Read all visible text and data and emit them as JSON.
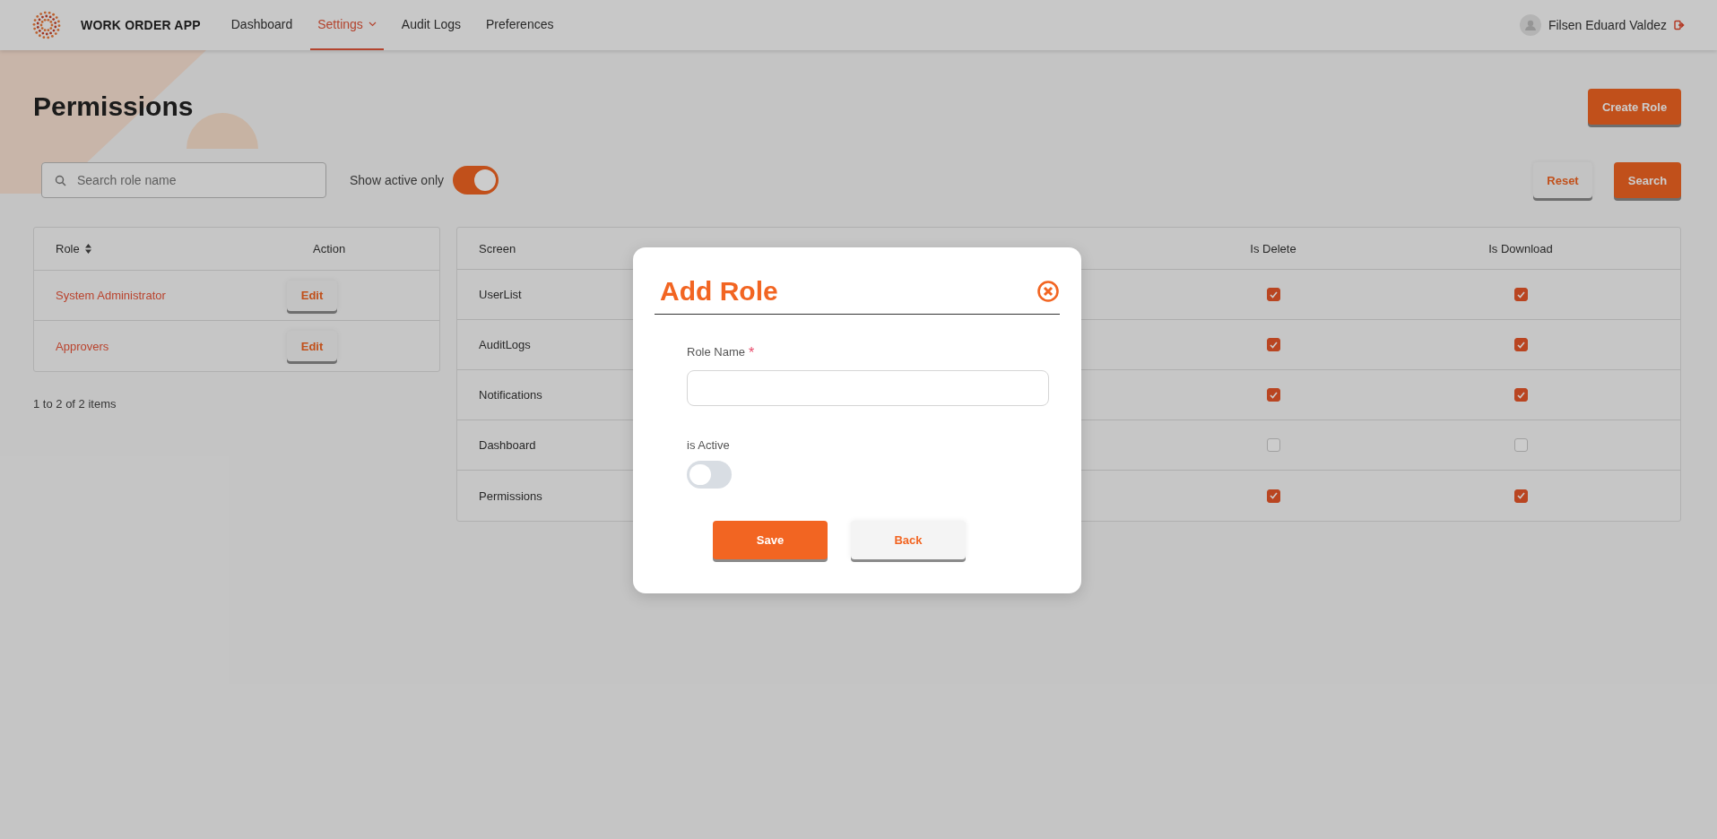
{
  "app": {
    "title": "WORK ORDER APP"
  },
  "nav": [
    {
      "label": "Dashboard",
      "selected": false,
      "dropdown": false
    },
    {
      "label": "Settings",
      "selected": true,
      "dropdown": true
    },
    {
      "label": "Audit Logs",
      "selected": false,
      "dropdown": false
    },
    {
      "label": "Preferences",
      "selected": false,
      "dropdown": false
    }
  ],
  "user": {
    "name": "Filsen Eduard Valdez"
  },
  "page": {
    "title": "Permissions",
    "create_button": "Create Role"
  },
  "filters": {
    "search": {
      "placeholder": "Search role name"
    },
    "show_active": {
      "label": "Show active only",
      "on": true
    },
    "reset_button": "Reset",
    "search_button": "Search"
  },
  "roles_table": {
    "columns": [
      "Role",
      "Action"
    ],
    "rows": [
      {
        "role": "System Administrator",
        "action": "Edit"
      },
      {
        "role": "Approvers",
        "action": "Edit"
      }
    ],
    "footer": "1 to 2 of 2 items"
  },
  "permissions_table": {
    "columns": [
      "Screen",
      null,
      null,
      "Is Delete",
      "Is Download"
    ],
    "rows": [
      {
        "screen": "UserList",
        "is_delete": true,
        "is_download": true
      },
      {
        "screen": "AuditLogs",
        "is_delete": true,
        "is_download": true
      },
      {
        "screen": "Notifications",
        "is_delete": true,
        "is_download": true
      },
      {
        "screen": "Dashboard",
        "is_delete": false,
        "is_download": false
      },
      {
        "screen": "Permissions",
        "is_delete": true,
        "is_download": true
      }
    ]
  },
  "modal": {
    "title": "Add Role",
    "field": {
      "label": "Role Name",
      "required_mark": "*"
    },
    "active": {
      "label": "is Active",
      "on": false
    },
    "buttons": [
      {
        "label": "Save",
        "kind": "primary"
      },
      {
        "label": "Back",
        "kind": "secondary"
      }
    ]
  }
}
